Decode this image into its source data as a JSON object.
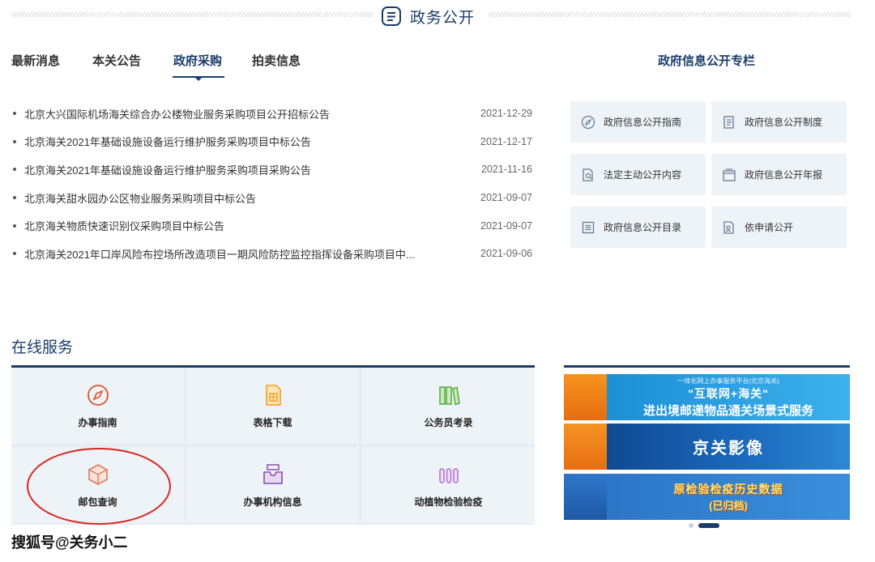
{
  "header": {
    "title": "政务公开",
    "icon": "list-doc-icon"
  },
  "tabs": [
    {
      "label": "最新消息",
      "active": false
    },
    {
      "label": "本关公告",
      "active": false
    },
    {
      "label": "政府采购",
      "active": true
    },
    {
      "label": "拍卖信息",
      "active": false
    }
  ],
  "news": [
    {
      "title": "北京大兴国际机场海关综合办公楼物业服务采购项目公开招标公告",
      "date": "2021-12-29"
    },
    {
      "title": "北京海关2021年基础设施设备运行维护服务采购项目中标公告",
      "date": "2021-12-17"
    },
    {
      "title": "北京海关2021年基础设施设备运行维护服务采购项目采购公告",
      "date": "2021-11-16"
    },
    {
      "title": "北京海关甜水园办公区物业服务采购项目中标公告",
      "date": "2021-09-07"
    },
    {
      "title": "北京海关物质快速识别仪采购项目中标公告",
      "date": "2021-09-07"
    },
    {
      "title": "北京海关2021年口岸风险布控场所改造项目一期风险防控监控指挥设备采购项目中...",
      "date": "2021-09-06"
    }
  ],
  "gov_column": {
    "title": "政府信息公开专栏",
    "items": [
      {
        "label": "政府信息公开指南",
        "icon": "compass-icon"
      },
      {
        "label": "政府信息公开制度",
        "icon": "document-icon"
      },
      {
        "label": "法定主动公开内容",
        "icon": "file-search-icon"
      },
      {
        "label": "政府信息公开年报",
        "icon": "folder-icon"
      },
      {
        "label": "政府信息公开目录",
        "icon": "list-icon"
      },
      {
        "label": "依申请公开",
        "icon": "file-apply-icon"
      }
    ]
  },
  "services": {
    "title": "在线服务",
    "items": [
      {
        "label": "办事指南",
        "icon": "compass-icon",
        "color": "#d9552b"
      },
      {
        "label": "表格下载",
        "icon": "form-icon",
        "color": "#f0a020"
      },
      {
        "label": "公务员考录",
        "icon": "books-icon",
        "color": "#4fae3a"
      },
      {
        "label": "邮包查询",
        "icon": "package-icon",
        "color": "#e07a5a"
      },
      {
        "label": "办事机构信息",
        "icon": "inbox-icon",
        "color": "#8a4db0"
      },
      {
        "label": "动植物检验检疫",
        "icon": "bars-icon",
        "color": "#b06ad0"
      }
    ]
  },
  "banners": [
    {
      "small": "一体化网上办事服务平台(北京海关)",
      "mid": "\"互联网+海关\"",
      "big": "进出境邮递物品通关场景式服务"
    },
    {
      "big": "京关影像"
    },
    {
      "big": "原检验检疫历史数据",
      "mid": "(已归档)"
    }
  ],
  "carousel": {
    "count": 2,
    "active": 1
  },
  "watermark": "搜狐号@关务小二"
}
